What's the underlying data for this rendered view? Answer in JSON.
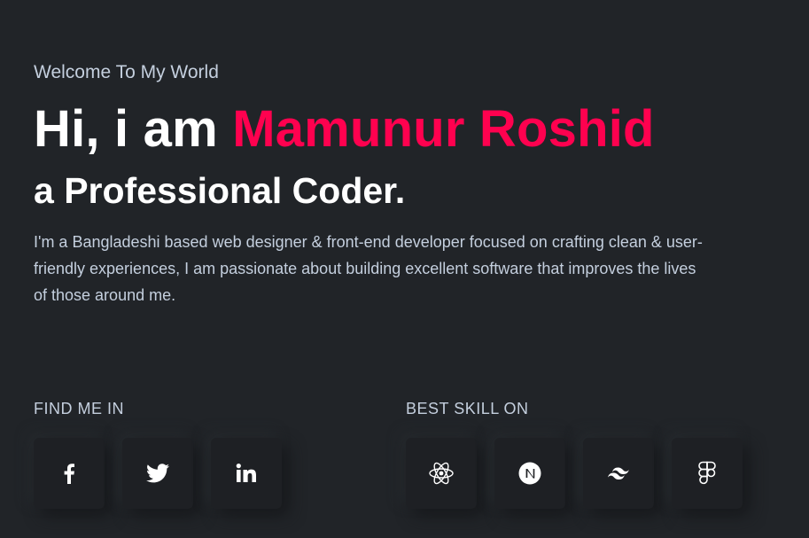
{
  "hero": {
    "welcome": "Welcome To My World",
    "greeting": "Hi, i am ",
    "name": "Mamunur Roshid",
    "subtitle": "a Professional Coder.",
    "bio": "I'm a Bangladeshi based web designer & front-end developer focused on crafting clean & user-friendly experiences, I am passionate about building excellent software that improves the lives of those around me."
  },
  "find_me": {
    "title": "FIND ME IN",
    "links": [
      {
        "icon": "facebook-icon"
      },
      {
        "icon": "twitter-icon"
      },
      {
        "icon": "linkedin-icon"
      }
    ]
  },
  "skills": {
    "title": "BEST SKILL ON",
    "items": [
      {
        "icon": "react-icon"
      },
      {
        "icon": "nextjs-icon"
      },
      {
        "icon": "tailwind-icon"
      },
      {
        "icon": "figma-icon"
      }
    ]
  },
  "colors": {
    "background": "#212428",
    "accent": "#ff014f",
    "text": "#c4cfde",
    "heading": "#ffffff",
    "card": "#1e2024"
  }
}
